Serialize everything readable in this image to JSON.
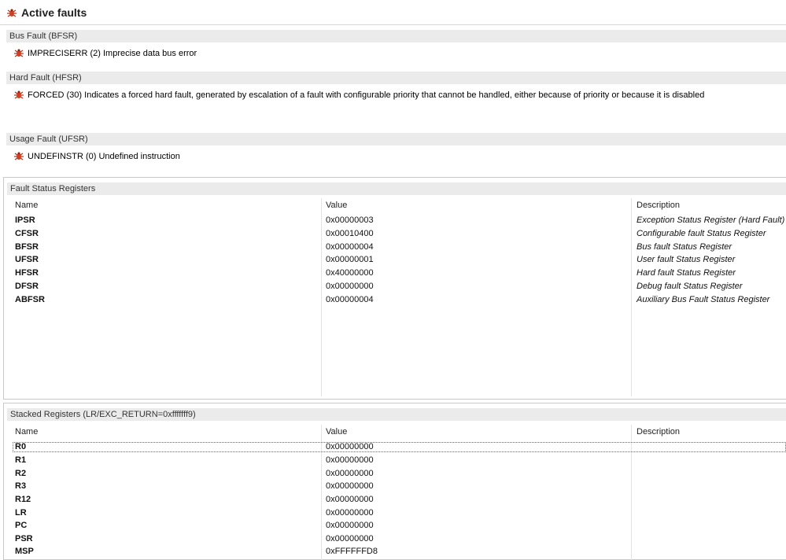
{
  "title": "Active faults",
  "sections": {
    "bfsr": {
      "header": "Bus Fault (BFSR)",
      "fault": {
        "code": "IMPRECISERR",
        "num": "(2)",
        "text": "Imprecise data bus error"
      }
    },
    "hfsr": {
      "header": "Hard Fault (HFSR)",
      "fault": {
        "code": "FORCED",
        "num": "(30)",
        "text": "Indicates a forced hard fault, generated by escalation of a fault with configurable priority that cannot be handled, either because of priority or because it is disabled"
      }
    },
    "ufsr": {
      "header": "Usage Fault (UFSR)",
      "fault": {
        "code": "UNDEFINSTR",
        "num": "(0)",
        "text": "Undefined instruction"
      }
    }
  },
  "fault_status": {
    "header": "Fault Status Registers",
    "columns": {
      "name": "Name",
      "value": "Value",
      "description": "Description"
    },
    "rows": [
      {
        "name": "IPSR",
        "value": "0x00000003",
        "description": "Exception Status Register (Hard Fault)"
      },
      {
        "name": "CFSR",
        "value": "0x00010400",
        "description": "Configurable fault Status Register"
      },
      {
        "name": "BFSR",
        "value": "0x00000004",
        "description": "Bus fault Status Register"
      },
      {
        "name": "UFSR",
        "value": "0x00000001",
        "description": "User fault Status Register"
      },
      {
        "name": "HFSR",
        "value": "0x40000000",
        "description": "Hard fault Status Register"
      },
      {
        "name": "DFSR",
        "value": "0x00000000",
        "description": "Debug fault Status Register"
      },
      {
        "name": "ABFSR",
        "value": "0x00000004",
        "description": "Auxiliary Bus Fault Status Register"
      }
    ]
  },
  "stacked": {
    "header": "Stacked Registers (LR/EXC_RETURN=0xfffffff9)",
    "columns": {
      "name": "Name",
      "value": "Value",
      "description": "Description"
    },
    "rows": [
      {
        "name": "R0",
        "value": "0x00000000",
        "description": ""
      },
      {
        "name": "R1",
        "value": "0x00000000",
        "description": ""
      },
      {
        "name": "R2",
        "value": "0x00000000",
        "description": ""
      },
      {
        "name": "R3",
        "value": "0x00000000",
        "description": ""
      },
      {
        "name": "R12",
        "value": "0x00000000",
        "description": ""
      },
      {
        "name": "LR",
        "value": "0x00000000",
        "description": ""
      },
      {
        "name": "PC",
        "value": "0x00000000",
        "description": ""
      },
      {
        "name": "PSR",
        "value": "0x00000000",
        "description": ""
      },
      {
        "name": "MSP",
        "value": "0xFFFFFFD8",
        "description": ""
      }
    ]
  }
}
